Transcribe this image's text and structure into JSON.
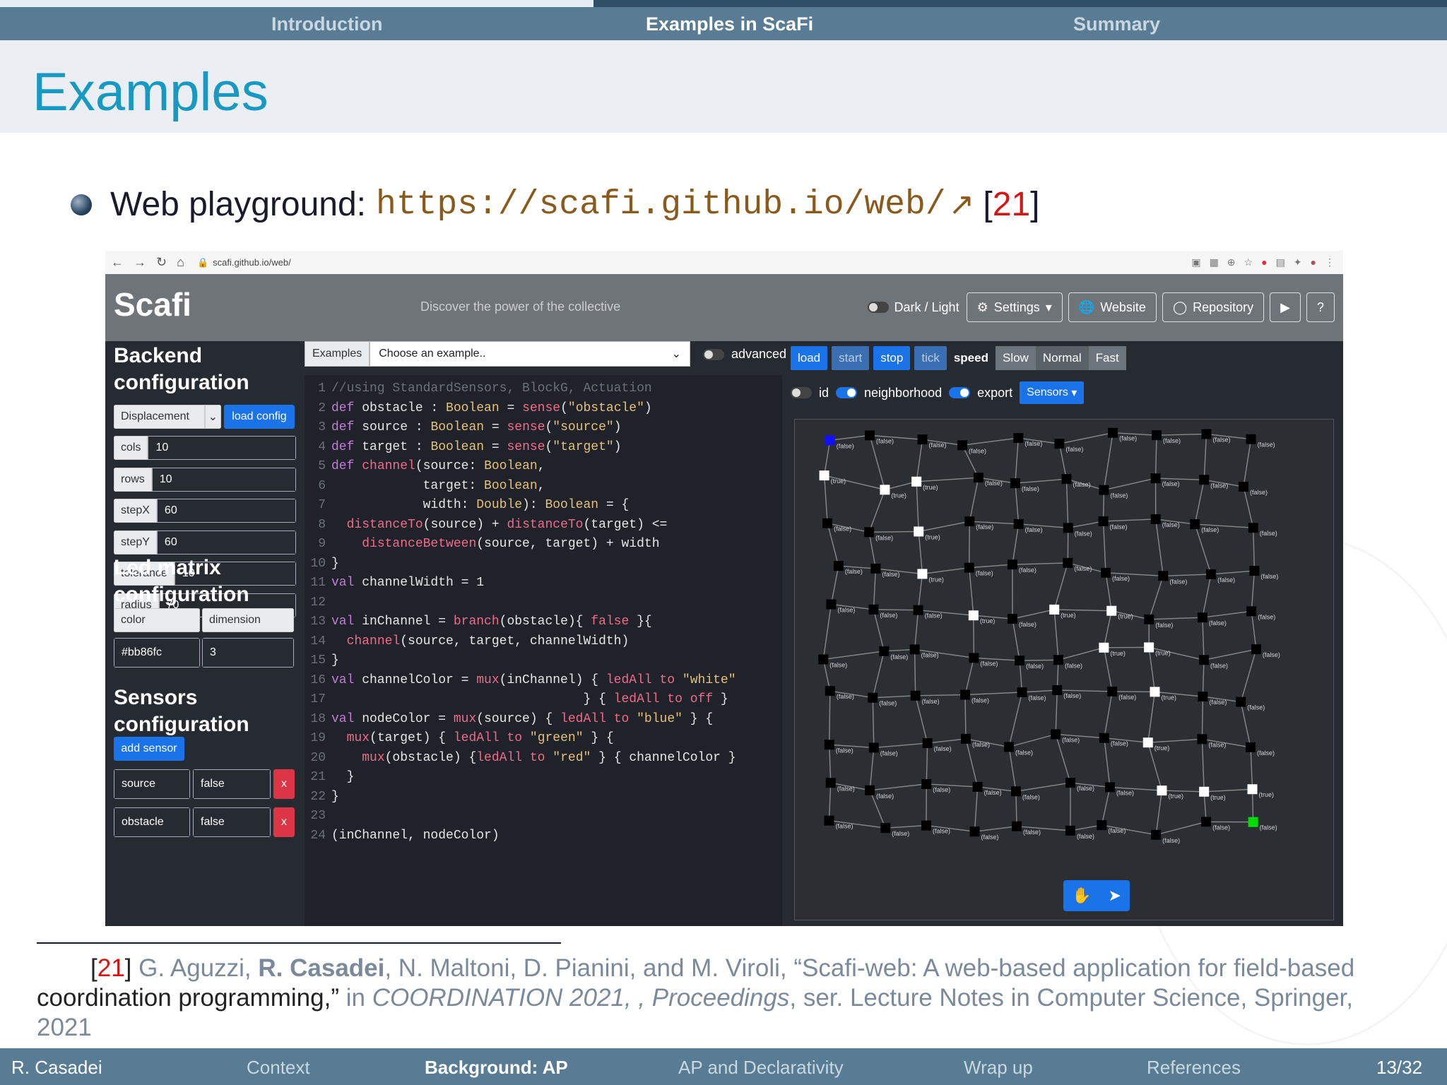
{
  "top_nav": {
    "items": [
      "Introduction",
      "Examples in ScaFi",
      "Summary"
    ],
    "active": 1
  },
  "slide": {
    "title": "Examples"
  },
  "bullet": {
    "label": "Web playground:",
    "url": "https://scafi.github.io/web/",
    "citation": "21"
  },
  "browser": {
    "address": "scafi.github.io/web/"
  },
  "app": {
    "brand": "Scafi",
    "tagline": "Discover the power of the collective",
    "header_buttons": {
      "dark_light": "Dark / Light",
      "settings": "Settings",
      "website": "Website",
      "repository": "Repository"
    },
    "backend": {
      "title_1": "Backend",
      "title_2": "configuration",
      "program": "Displacement",
      "load_config": "load config",
      "fields": [
        {
          "label": "cols",
          "value": "10"
        },
        {
          "label": "rows",
          "value": "10"
        },
        {
          "label": "stepX",
          "value": "60"
        },
        {
          "label": "stepY",
          "value": "60"
        },
        {
          "label": "tolerance",
          "value": "10"
        },
        {
          "label": "radius",
          "value": "70"
        }
      ]
    },
    "led": {
      "title_1": "Led matrix",
      "title_2": "configuration",
      "color_label": "color",
      "dimension_label": "dimension",
      "color_value": "#bb86fc",
      "dimension_value": "3"
    },
    "sensors": {
      "title_1": "Sensors",
      "title_2": "configuration",
      "add": "add sensor",
      "list": [
        {
          "name": "source",
          "value": "false"
        },
        {
          "name": "obstacle",
          "value": "false"
        }
      ],
      "remove": "x"
    },
    "examples": {
      "label": "Examples",
      "placeholder": "Choose an example.."
    },
    "advanced": "advanced",
    "code": [
      "//using StandardSensors, BlockG, Actuation",
      "def obstacle : Boolean = sense(\"obstacle\")",
      "def source : Boolean = sense(\"source\")",
      "def target : Boolean = sense(\"target\")",
      "def channel(source: Boolean,",
      "            target: Boolean,",
      "            width: Double): Boolean = {",
      "  distanceTo(source) + distanceTo(target) <=",
      "    distanceBetween(source, target) + width",
      "}",
      "val channelWidth = 1",
      "",
      "val inChannel = branch(obstacle){ false }{",
      "  channel(source, target, channelWidth)",
      "}",
      "val channelColor = mux(inChannel) { ledAll to \"white\"",
      "                                 } { ledAll to off }",
      "val nodeColor = mux(source) { ledAll to \"blue\" } {",
      "  mux(target) { ledAll to \"green\" } {",
      "    mux(obstacle) {ledAll to \"red\" } { channelColor }",
      "  }",
      "}",
      "",
      "(inChannel, nodeColor)"
    ],
    "controls": {
      "load": "load",
      "start": "start",
      "stop": "stop",
      "tick": "tick",
      "speed": "speed",
      "slow": "Slow",
      "normal": "Normal",
      "fast": "Fast"
    },
    "toggles": {
      "id": "id",
      "neighborhood": "neighborhood",
      "export": "export",
      "sensors": "Sensors"
    },
    "node_label_false": "(false)",
    "node_label_true": "(true)"
  },
  "reference": {
    "number": "21",
    "authors_a": "G. Aguzzi,",
    "authors_bold": "R. Casadei",
    "authors_b": ", N. Maltoni, D. Pianini, and M. Viroli, “Scafi-web: A web-based application for field-based",
    "line2_a": "coordination programming,”",
    "line2_b": " in ",
    "line2_venue": "COORDINATION 2021, , Proceedings",
    "line2_c": ", ser. Lecture Notes in Computer Science, Springer,",
    "line3": "2021"
  },
  "footer": {
    "author": "R. Casadei",
    "sections": [
      "Context",
      "Background: AP",
      "AP and Declarativity",
      "Wrap up",
      "References"
    ],
    "active": 1,
    "page": "13/32"
  }
}
